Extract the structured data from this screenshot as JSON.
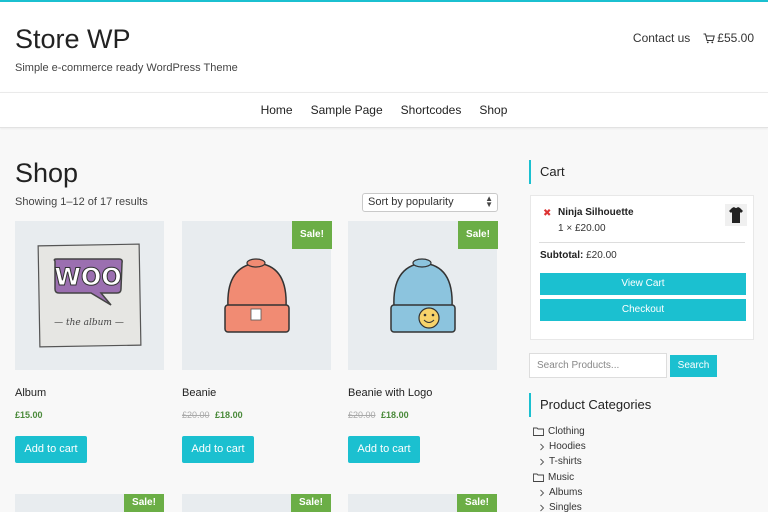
{
  "site": {
    "title": "Store WP",
    "tagline": "Simple e-commerce ready WordPress Theme",
    "contact": "Contact us",
    "cart_total": "£55.00"
  },
  "nav": [
    "Home",
    "Sample Page",
    "Shortcodes",
    "Shop"
  ],
  "shop": {
    "title": "Shop",
    "result_count": "Showing 1–12 of 17 results",
    "sort_selected": "Sort by popularity"
  },
  "products": [
    {
      "name": "Album",
      "price": "£15.00",
      "old_price": "",
      "sale": "",
      "button": "Add to cart"
    },
    {
      "name": "Beanie",
      "price": "£18.00",
      "old_price": "£20.00",
      "sale": "Sale!",
      "button": "Add to cart"
    },
    {
      "name": "Beanie with Logo",
      "price": "£18.00",
      "old_price": "£20.00",
      "sale": "Sale!",
      "button": "Add to cart"
    }
  ],
  "row2_sale": [
    "Sale!",
    "Sale!",
    "Sale!"
  ],
  "cart_widget": {
    "title": "Cart",
    "item_remove": "✖",
    "item_name": "Ninja Silhouette",
    "item_qty": "1 × £20.00",
    "subtotal_label": "Subtotal:",
    "subtotal_value": "£20.00",
    "view_cart": "View Cart",
    "checkout": "Checkout"
  },
  "search": {
    "placeholder": "Search Products...",
    "button": "Search"
  },
  "categories": {
    "title": "Product Categories",
    "items": [
      {
        "label": "Clothing",
        "level": 0
      },
      {
        "label": "Hoodies",
        "level": 1
      },
      {
        "label": "T-shirts",
        "level": 1
      },
      {
        "label": "Music",
        "level": 0
      },
      {
        "label": "Albums",
        "level": 1
      },
      {
        "label": "Singles",
        "level": 1
      }
    ]
  },
  "colors": {
    "accent": "#1bc0d0",
    "sale": "#6bae46",
    "price": "#4a8a3a"
  }
}
